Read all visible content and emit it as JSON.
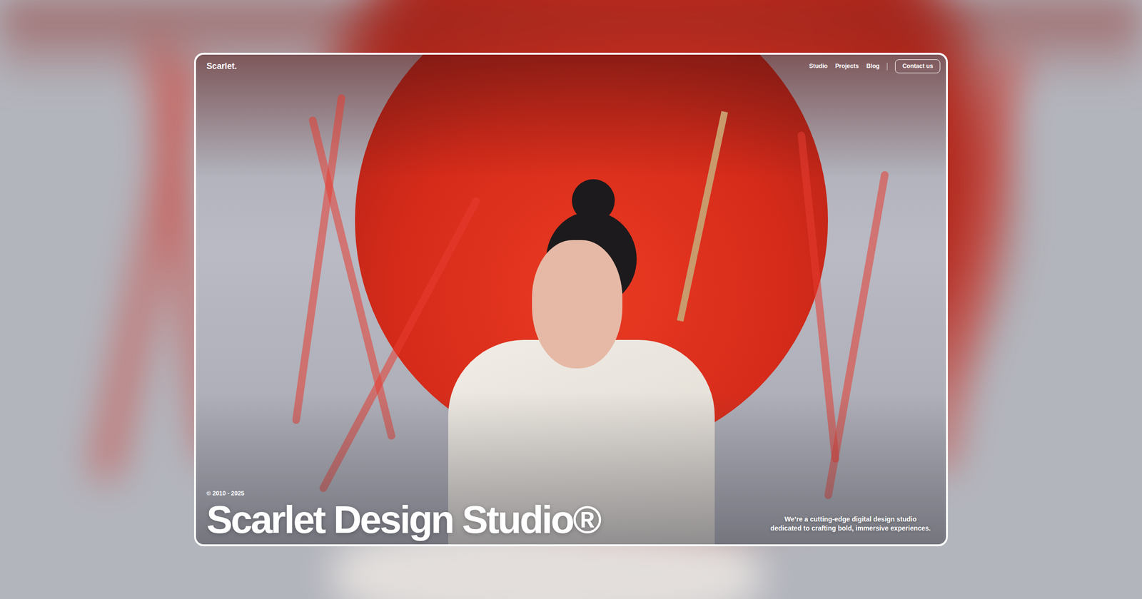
{
  "brand": {
    "logo": "Scarlet."
  },
  "nav": {
    "items": [
      {
        "label": "Studio"
      },
      {
        "label": "Projects"
      },
      {
        "label": "Blog"
      }
    ],
    "cta": "Contact us"
  },
  "hero": {
    "copyright": "© 2010 - 2025",
    "title": "Scarlet Design Studio®",
    "description_lines": [
      "We’re a cutting-edge digital design studio",
      "dedicated to crafting bold, immersive experiences."
    ]
  }
}
